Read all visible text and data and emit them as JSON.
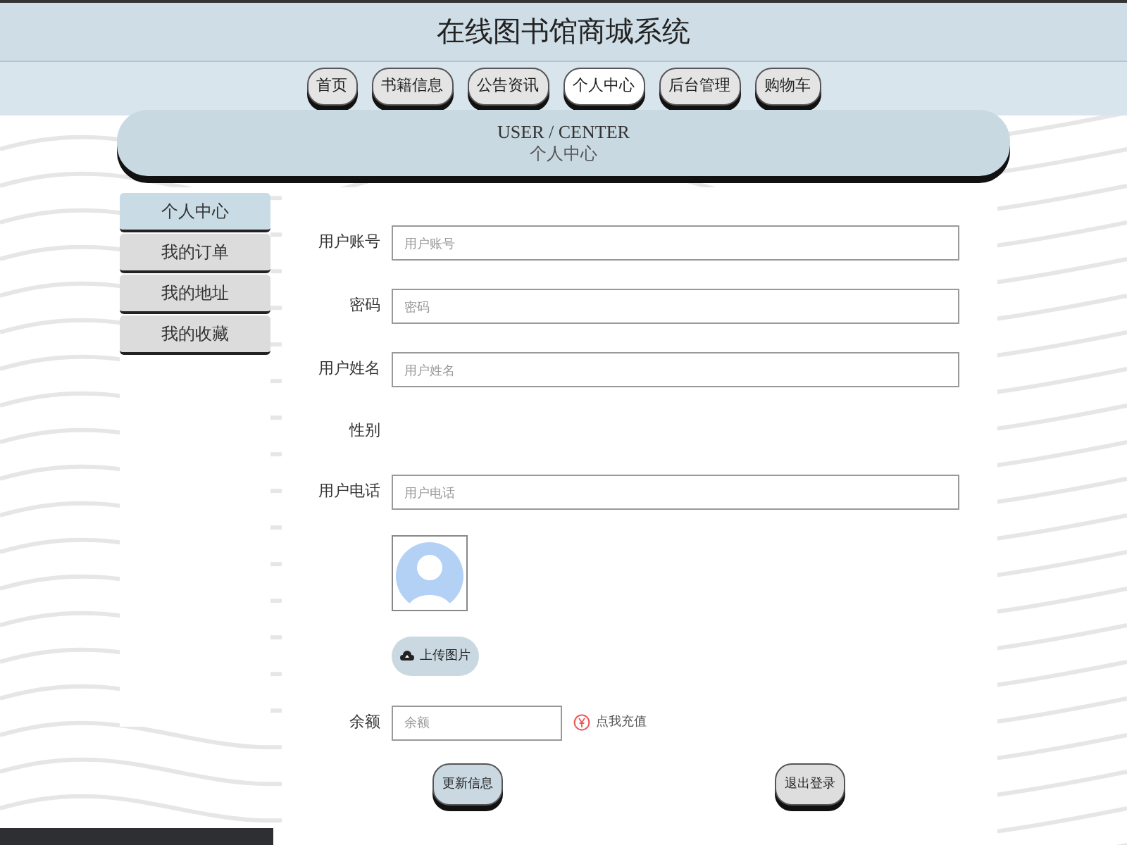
{
  "header": {
    "title": "在线图书馆商城系统"
  },
  "nav": [
    {
      "label": "首页",
      "selected": false
    },
    {
      "label": "书籍信息",
      "selected": false
    },
    {
      "label": "公告资讯",
      "selected": false
    },
    {
      "label": "个人中心",
      "selected": true
    },
    {
      "label": "后台管理",
      "selected": false
    },
    {
      "label": "购物车",
      "selected": false
    }
  ],
  "banner": {
    "title": "USER / CENTER",
    "subtitle": "个人中心"
  },
  "sidebar": {
    "items": [
      {
        "label": "个人中心",
        "selected": true
      },
      {
        "label": "我的订单",
        "selected": false
      },
      {
        "label": "我的地址",
        "selected": false
      },
      {
        "label": "我的收藏",
        "selected": false
      }
    ]
  },
  "form": {
    "fields": [
      {
        "kind": "input",
        "label": "用户账号",
        "placeholder": "用户账号"
      },
      {
        "kind": "input",
        "label": "密码",
        "placeholder": "密码"
      },
      {
        "kind": "input",
        "label": "用户姓名",
        "placeholder": "用户姓名"
      },
      {
        "kind": "label",
        "label": "性别"
      },
      {
        "kind": "input",
        "label": "用户电话",
        "placeholder": "用户电话"
      },
      {
        "kind": "avatar",
        "button": "上传图片"
      },
      {
        "kind": "balance",
        "label": "余额",
        "placeholder": "余额",
        "link": "点我充值"
      }
    ],
    "buttons": [
      {
        "label": "更新信息",
        "kind": "primary"
      },
      {
        "label": "退出登录",
        "kind": "secondary"
      }
    ]
  }
}
